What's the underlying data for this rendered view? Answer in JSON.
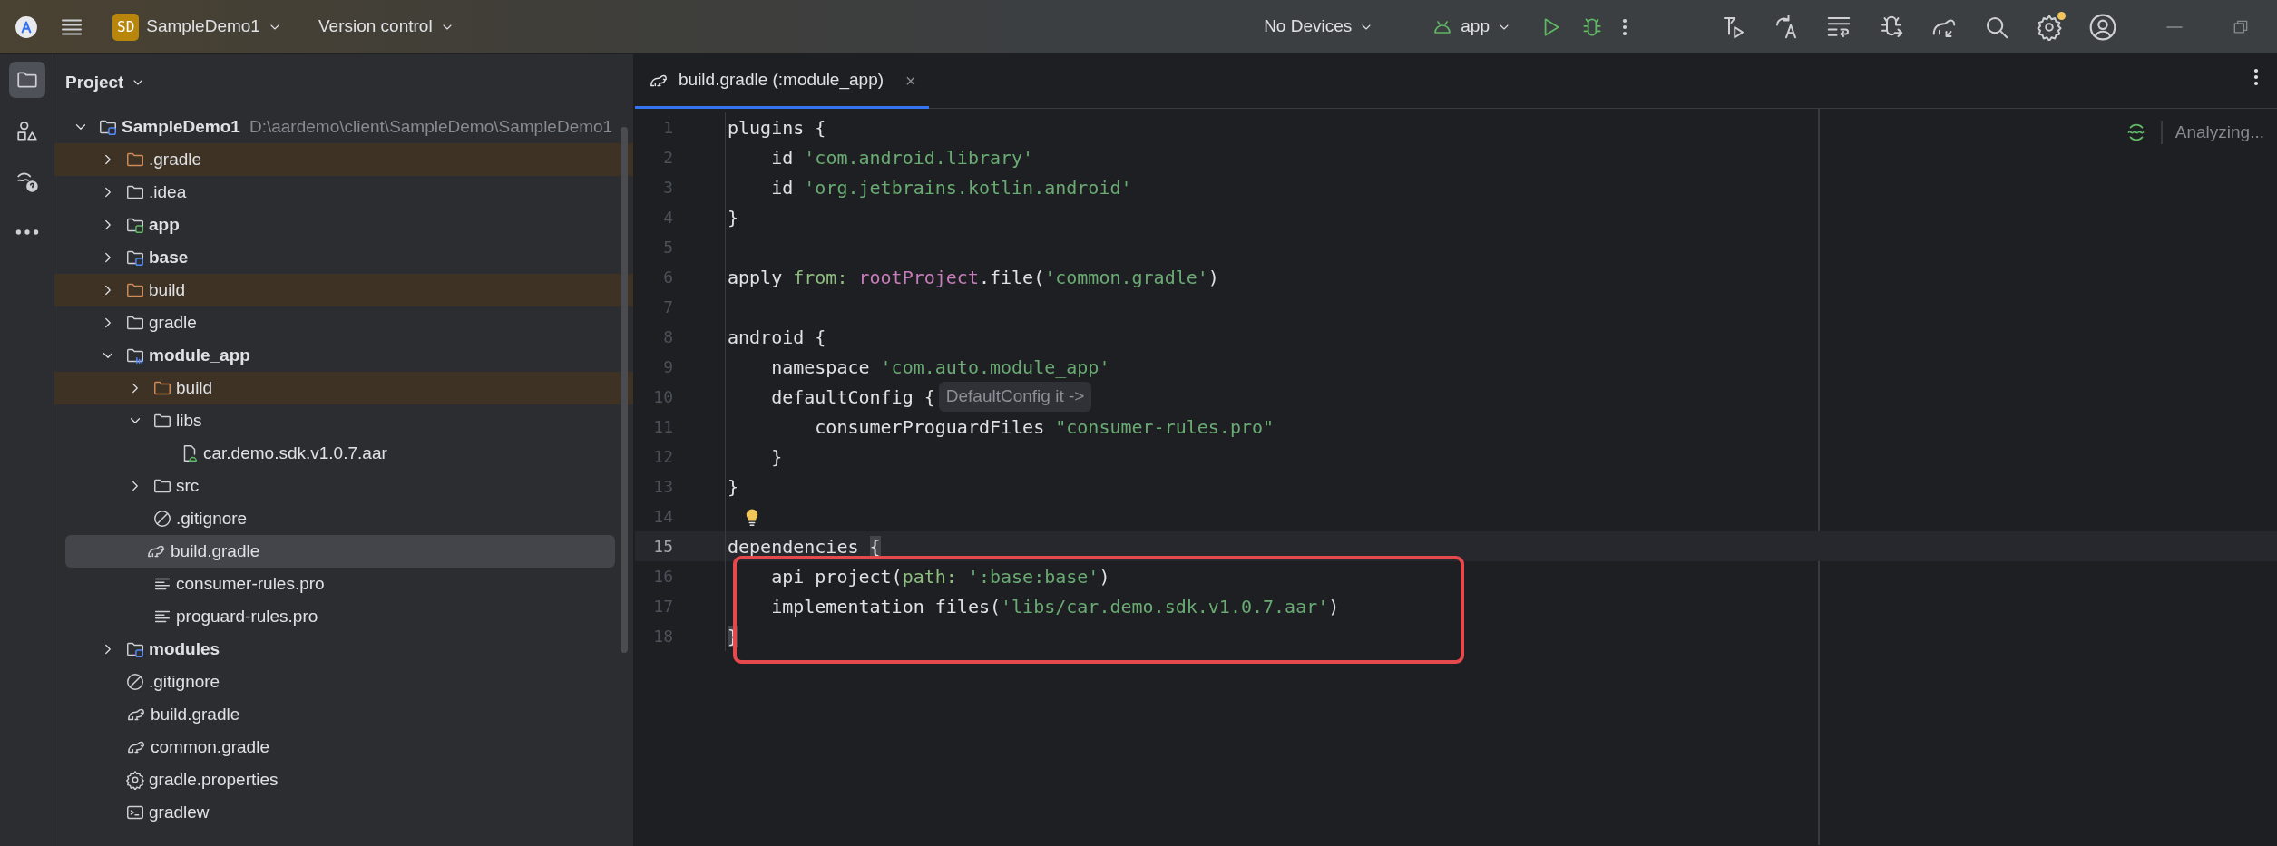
{
  "toolbar": {
    "project_badge": "SD",
    "project": "SampleDemo1",
    "vcs": "Version control",
    "device": "No Devices",
    "run_config": "app",
    "settings_notification": true
  },
  "tool_windows": [
    {
      "kind": "project",
      "selected": true
    },
    {
      "kind": "structure",
      "selected": false
    },
    {
      "kind": "help",
      "selected": false
    },
    {
      "kind": "more",
      "selected": false
    }
  ],
  "project_panel": {
    "title": "Project",
    "tree": [
      {
        "name": "SampleDemo1",
        "path": "D:\\aardemo\\client\\SampleDemo\\SampleDemo1",
        "kind": "module",
        "bold": true,
        "expanded": true,
        "excluded": false,
        "selected": false,
        "children": [
          {
            "name": ".gradle",
            "kind": "folder",
            "bold": false,
            "expanded": false,
            "excluded": true,
            "selected": false
          },
          {
            "name": ".idea",
            "kind": "folder",
            "bold": false,
            "expanded": false,
            "excluded": false,
            "selected": false
          },
          {
            "name": "app",
            "kind": "android_module",
            "bold": true,
            "expanded": false,
            "excluded": false,
            "selected": false
          },
          {
            "name": "base",
            "kind": "module",
            "bold": true,
            "expanded": false,
            "excluded": false,
            "selected": false
          },
          {
            "name": "build",
            "kind": "folder",
            "bold": false,
            "expanded": false,
            "excluded": true,
            "selected": false
          },
          {
            "name": "gradle",
            "kind": "folder",
            "bold": false,
            "expanded": false,
            "excluded": false,
            "selected": false
          },
          {
            "name": "module_app",
            "kind": "library_module",
            "bold": true,
            "expanded": true,
            "excluded": false,
            "selected": false,
            "children": [
              {
                "name": "build",
                "kind": "folder",
                "bold": false,
                "expanded": false,
                "excluded": true,
                "selected": false
              },
              {
                "name": "libs",
                "kind": "folder",
                "bold": false,
                "expanded": true,
                "excluded": false,
                "selected": false,
                "children": [
                  {
                    "name": "car.demo.sdk.v1.0.7.aar",
                    "kind": "aar",
                    "bold": false,
                    "excluded": false,
                    "selected": false
                  }
                ]
              },
              {
                "name": "src",
                "kind": "folder",
                "bold": false,
                "expanded": false,
                "excluded": false,
                "selected": false
              },
              {
                "name": ".gitignore",
                "kind": "ignore",
                "bold": false,
                "excluded": false,
                "selected": false
              },
              {
                "name": "build.gradle",
                "kind": "gradle",
                "bold": false,
                "excluded": false,
                "selected": true
              },
              {
                "name": "consumer-rules.pro",
                "kind": "text",
                "bold": false,
                "excluded": false,
                "selected": false
              },
              {
                "name": "proguard-rules.pro",
                "kind": "text",
                "bold": false,
                "excluded": false,
                "selected": false
              }
            ]
          },
          {
            "name": "modules",
            "kind": "module",
            "bold": true,
            "expanded": false,
            "excluded": false,
            "selected": false
          },
          {
            "name": ".gitignore",
            "kind": "ignore",
            "bold": false,
            "excluded": false,
            "selected": false
          },
          {
            "name": "build.gradle",
            "kind": "gradle",
            "bold": false,
            "excluded": false,
            "selected": false
          },
          {
            "name": "common.gradle",
            "kind": "gradle",
            "bold": false,
            "excluded": false,
            "selected": false
          },
          {
            "name": "gradle.properties",
            "kind": "settings",
            "bold": false,
            "excluded": false,
            "selected": false
          },
          {
            "name": "gradlew",
            "kind": "terminal",
            "bold": false,
            "excluded": false,
            "selected": false
          }
        ]
      }
    ]
  },
  "editor": {
    "tabs": [
      {
        "label": "build.gradle (:module_app)",
        "close": "×",
        "selected": true
      }
    ],
    "status": "Analyzing...",
    "lines": [
      {
        "number": "1",
        "current": false,
        "boxed": false,
        "bulb": false,
        "tokens": [
          {
            "kind": "plain",
            "text": "plugins {"
          }
        ]
      },
      {
        "number": "2",
        "current": false,
        "boxed": false,
        "bulb": false,
        "tokens": [
          {
            "kind": "plain",
            "text": "    id "
          },
          {
            "kind": "string",
            "text": "'com.android.library'"
          }
        ]
      },
      {
        "number": "3",
        "current": false,
        "boxed": false,
        "bulb": false,
        "tokens": [
          {
            "kind": "plain",
            "text": "    id "
          },
          {
            "kind": "string",
            "text": "'org.jetbrains.kotlin.android'"
          }
        ]
      },
      {
        "number": "4",
        "current": false,
        "boxed": false,
        "bulb": false,
        "tokens": [
          {
            "kind": "plain",
            "text": "}"
          }
        ]
      },
      {
        "number": "5",
        "current": false,
        "boxed": false,
        "bulb": false
      },
      {
        "number": "6",
        "current": false,
        "boxed": false,
        "bulb": false,
        "tokens": [
          {
            "kind": "plain",
            "text": "apply "
          },
          {
            "kind": "named_arg",
            "text": "from: "
          },
          {
            "kind": "property",
            "text": "rootProject"
          },
          {
            "kind": "plain",
            "text": ".file("
          },
          {
            "kind": "string",
            "text": "'common.gradle'"
          },
          {
            "kind": "plain",
            "text": ")"
          }
        ]
      },
      {
        "number": "7",
        "current": false,
        "boxed": false,
        "bulb": false
      },
      {
        "number": "8",
        "current": false,
        "boxed": false,
        "bulb": false,
        "tokens": [
          {
            "kind": "plain",
            "text": "android {"
          }
        ]
      },
      {
        "number": "9",
        "current": false,
        "boxed": false,
        "bulb": false,
        "tokens": [
          {
            "kind": "plain",
            "text": "    namespace "
          },
          {
            "kind": "string",
            "text": "'com.auto.module_app'"
          }
        ]
      },
      {
        "number": "10",
        "current": false,
        "boxed": false,
        "bulb": false,
        "tokens": [
          {
            "kind": "plain",
            "text": "    defaultConfig {"
          },
          {
            "kind": "hint",
            "text": "DefaultConfig it ->"
          }
        ]
      },
      {
        "number": "11",
        "current": false,
        "boxed": false,
        "bulb": false,
        "tokens": [
          {
            "kind": "plain",
            "text": "        consumerProguardFiles "
          },
          {
            "kind": "string",
            "text": "\"consumer-rules.pro\""
          }
        ]
      },
      {
        "number": "12",
        "current": false,
        "boxed": false,
        "bulb": false,
        "tokens": [
          {
            "kind": "plain",
            "text": "    }"
          }
        ]
      },
      {
        "number": "13",
        "current": false,
        "boxed": false,
        "bulb": false,
        "tokens": [
          {
            "kind": "plain",
            "text": "}"
          }
        ]
      },
      {
        "number": "14",
        "current": false,
        "boxed": false,
        "bulb": true
      },
      {
        "number": "15",
        "current": true,
        "boxed": false,
        "bulb": false,
        "tokens": [
          {
            "kind": "plain",
            "text": "dependencies "
          },
          {
            "kind": "brace_match",
            "text": "{"
          }
        ]
      },
      {
        "number": "16",
        "current": false,
        "boxed": true,
        "bulb": false,
        "tokens": [
          {
            "kind": "plain",
            "text": "    api project("
          },
          {
            "kind": "named_arg",
            "text": "path: "
          },
          {
            "kind": "string",
            "text": "':base:base'"
          },
          {
            "kind": "plain",
            "text": ")"
          }
        ]
      },
      {
        "number": "17",
        "current": false,
        "boxed": true,
        "bulb": false,
        "tokens": [
          {
            "kind": "plain",
            "text": "    implementation files("
          },
          {
            "kind": "string",
            "text": "'libs/car.demo.sdk.v1.0.7.aar'"
          },
          {
            "kind": "plain",
            "text": ")"
          }
        ]
      },
      {
        "number": "18",
        "current": false,
        "boxed": true,
        "bulb": false,
        "tokens": [
          {
            "kind": "brace_match",
            "text": "}"
          }
        ]
      }
    ]
  }
}
